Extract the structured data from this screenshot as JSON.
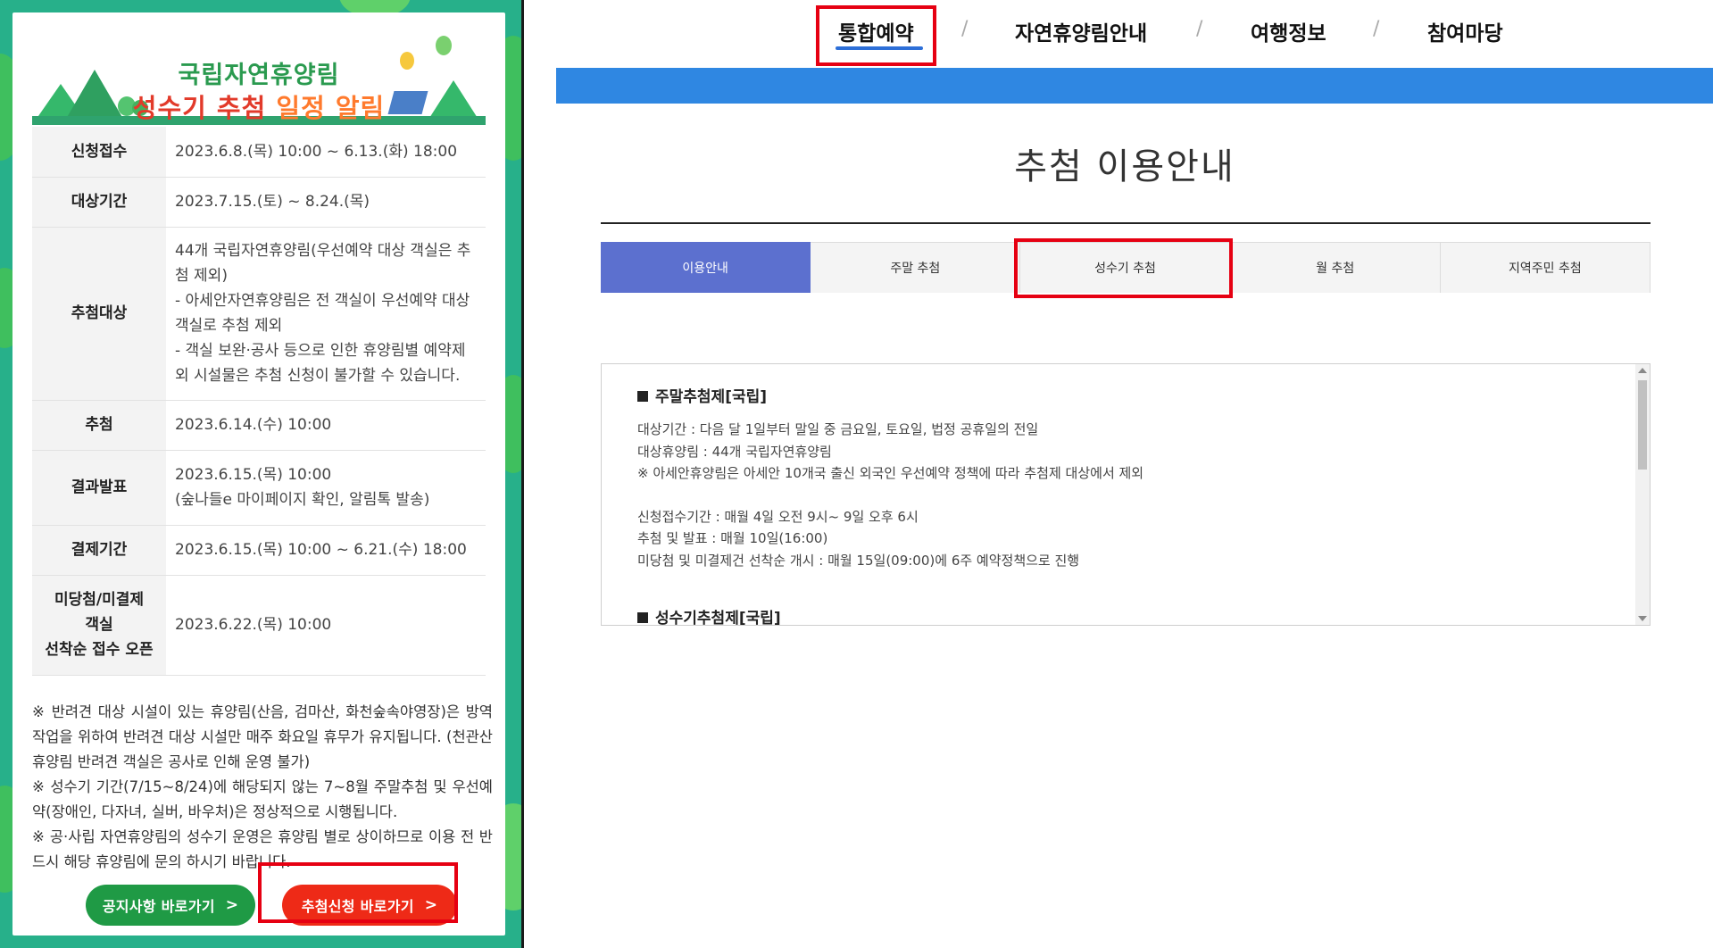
{
  "popup": {
    "banner": {
      "title_line1": "국립자연휴양림",
      "title_line2_part1": "성수기 추첨",
      "title_line2_part2": "일정 알림"
    },
    "schedule": [
      {
        "label": "신청접수",
        "value": "2023.6.8.(목) 10:00 ~ 6.13.(화) 18:00"
      },
      {
        "label": "대상기간",
        "value": "2023.7.15.(토) ~ 8.24.(목)"
      },
      {
        "label": "추첨대상",
        "value": "44개 국립자연휴양림(우선예약 대상 객실은 추첨 제외)\n- 아세안자연휴양림은 전 객실이 우선예약 대상 객실로 추첨 제외\n- 객실 보완·공사 등으로 인한 휴양림별 예약제외 시설물은 추첨 신청이 불가할 수 있습니다."
      },
      {
        "label": "추첨",
        "value": "2023.6.14.(수) 10:00"
      },
      {
        "label": "결과발표",
        "value": "2023.6.15.(목) 10:00\n(숲나들e 마이페이지 확인, 알림톡 발송)"
      },
      {
        "label": "결제기간",
        "value": "2023.6.15.(목) 10:00 ~ 6.21.(수) 18:00"
      },
      {
        "label": "미당첨/미결제\n객실\n선착순 접수 오픈",
        "value": "2023.6.22.(목) 10:00"
      }
    ],
    "notes": [
      "※ 반려견 대상 시설이 있는 휴양림(산음, 검마산, 화천숲속야영장)은 방역작업을 위하여 반려견 대상 시설만 매주 화요일 휴무가 유지됩니다. (천관산 휴양림 반려견 객실은 공사로 인해 운영 불가)",
      "※ 성수기 기간(7/15~8/24)에 해당되지 않는 7~8월 주말추첨 및 우선예약(장애인, 다자녀, 실버, 바우처)은 정상적으로 시행됩니다.",
      "※ 공·사립 자연휴양림의 성수기 운영은 휴양림 별로 상이하므로 이용 전 반드시 해당 휴양림에 문의 하시기 바랍니다."
    ],
    "buttons": {
      "notice": "공지사항 바로가기",
      "apply": "추첨신청 바로가기",
      "chevron": ">"
    }
  },
  "site": {
    "nav": [
      "통합예약",
      "자연휴양림안내",
      "여행정보",
      "참여마당"
    ],
    "nav_separator": "/",
    "page_title": "추첨 이용안내",
    "tabs": [
      "이용안내",
      "주말 추첨",
      "성수기 추첨",
      "월 추첨",
      "지역주민 추첨"
    ],
    "active_tab_index": 0,
    "info": {
      "section1_title": "주말추첨제[국립]",
      "lines_a": [
        "대상기간 : 다음 달 1일부터 말일 중 금요일, 토요일, 법정 공휴일의 전일",
        "대상휴양림 : 44개 국립자연휴양림",
        "※ 아세안휴양림은 아세안 10개국 출신 외국인 우선예약 정책에 따라 추첨제 대상에서 제외"
      ],
      "lines_b": [
        "신청접수기간 : 매월 4일 오전 9시~ 9일 오후 6시",
        "추첨 및 발표 : 매월 10일(16:00)",
        "미당첨 및 미결제건 선착순 개시 : 매월 15일(09:00)에 6주 예약정책으로 진행"
      ],
      "section2_title": "성수기추첨제[국립]"
    }
  },
  "colors": {
    "popup_bg": "#27b08a",
    "banner_green": "#2a9a4f",
    "banner_red": "#e23a2a",
    "notice_button": "#1f9a45",
    "apply_button": "#ee2a17",
    "highlight_box": "#e60012",
    "blue_bar": "#2f87e2",
    "active_tab": "#5c70cf"
  }
}
